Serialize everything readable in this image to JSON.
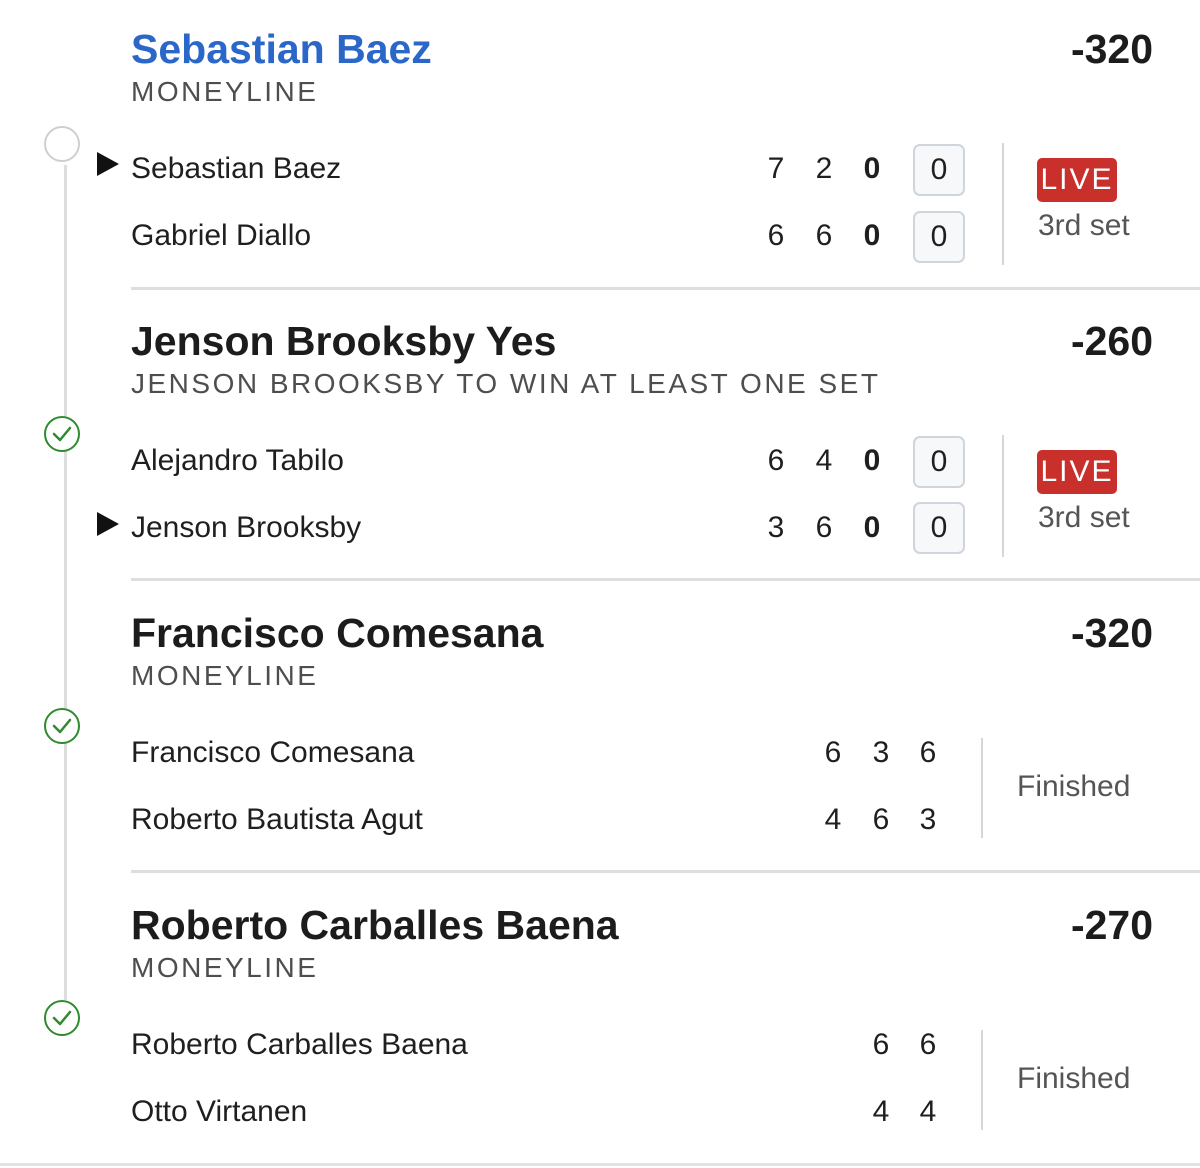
{
  "legs": [
    {
      "title": "Sebastian Baez",
      "market": "MONEYLINE",
      "odds": "-320",
      "result": "pending",
      "players": [
        {
          "name": "Sebastian Baez",
          "serving": true,
          "sets": [
            "7",
            "2",
            "0"
          ],
          "game": "0"
        },
        {
          "name": "Gabriel Diallo",
          "serving": false,
          "sets": [
            "6",
            "6",
            "0"
          ],
          "game": "0"
        }
      ],
      "live_label": "LIVE",
      "status_text": "3rd set"
    },
    {
      "title": "Jenson Brooksby Yes",
      "market": "JENSON BROOKSBY TO WIN AT LEAST ONE SET",
      "odds": "-260",
      "result": "won",
      "players": [
        {
          "name": "Alejandro Tabilo",
          "serving": false,
          "sets": [
            "6",
            "4",
            "0"
          ],
          "game": "0"
        },
        {
          "name": "Jenson Brooksby",
          "serving": true,
          "sets": [
            "3",
            "6",
            "0"
          ],
          "game": "0"
        }
      ],
      "live_label": "LIVE",
      "status_text": "3rd set"
    },
    {
      "title": "Francisco Comesana",
      "market": "MONEYLINE",
      "odds": "-320",
      "result": "won",
      "players": [
        {
          "name": "Francisco Comesana",
          "sets": [
            "6",
            "3",
            "6"
          ]
        },
        {
          "name": "Roberto Bautista Agut",
          "sets": [
            "4",
            "6",
            "3"
          ]
        }
      ],
      "status_text": "Finished"
    },
    {
      "title": "Roberto Carballes Baena",
      "market": "MONEYLINE",
      "odds": "-270",
      "result": "won",
      "players": [
        {
          "name": "Roberto Carballes Baena",
          "sets": [
            "6",
            "6"
          ]
        },
        {
          "name": "Otto Virtanen",
          "sets": [
            "4",
            "4"
          ]
        }
      ],
      "status_text": "Finished"
    }
  ],
  "colors": {
    "title_highlight": "#2a67c9",
    "live_badge": "#c9302c",
    "won_check": "#2e8b2e"
  }
}
